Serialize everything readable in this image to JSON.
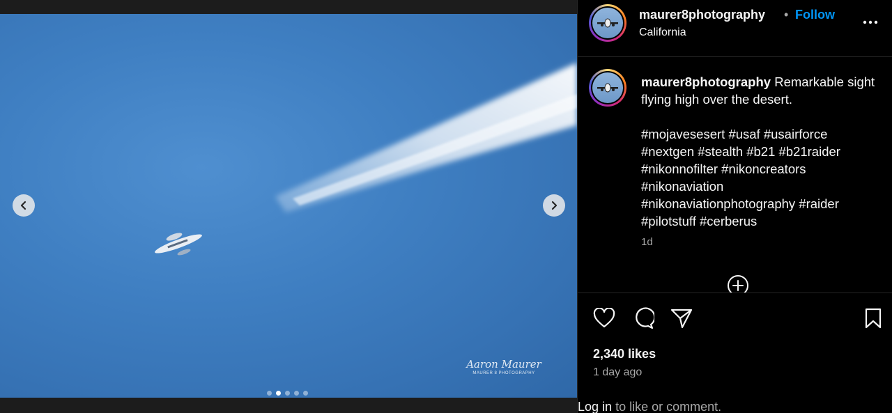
{
  "post": {
    "username": "maurer8photography",
    "separator": "•",
    "follow_label": "Follow",
    "location": "California",
    "more_icon": "more-horizontal-icon"
  },
  "photo": {
    "watermark_name": "Aaron Maurer",
    "watermark_sub": "MAURER 8 PHOTOGRAPHY",
    "slide_count": 5,
    "active_slide": 2,
    "sky_color": "#3f7fc2"
  },
  "caption": {
    "username": "maurer8photography",
    "text": "Remarkable sight flying high over the desert.",
    "hashtags": "#mojavesesert #usaf #usairforce\n#nextgen #stealth #b21 #b21raider\n#nikonnofilter #nikoncreators\n#nikonaviation\n#nikonaviationphotography #raider\n#pilotstuff #cerberus",
    "time": "1d"
  },
  "engagement": {
    "likes": "2,340 likes",
    "time_ago": "1 day ago"
  },
  "login": {
    "link": "Log in",
    "rest": "to like or comment."
  },
  "colors": {
    "accent": "#0095f6",
    "background": "#000000",
    "secondary_text": "#a8a8a8"
  }
}
